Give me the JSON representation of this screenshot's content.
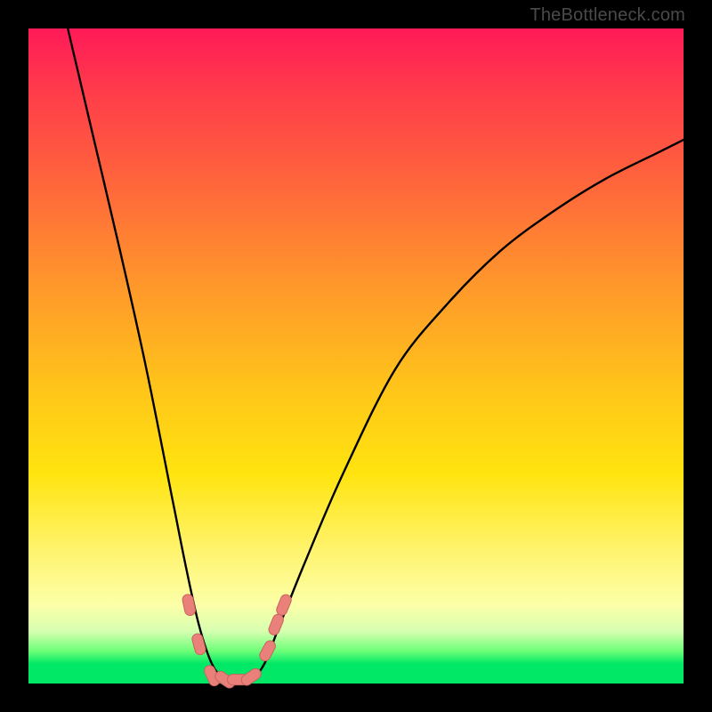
{
  "watermark": "TheBottleneck.com",
  "colors": {
    "frame_bg": "#000000",
    "gradient_top": "#ff1a58",
    "gradient_mid": "#ffe40f",
    "gradient_bottom": "#00e865",
    "curve_stroke": "#000000",
    "marker_fill": "#e98079",
    "marker_stroke": "#c9645f"
  },
  "chart_data": {
    "type": "line",
    "title": "",
    "xlabel": "",
    "ylabel": "",
    "xlim": [
      0,
      100
    ],
    "ylim": [
      0,
      100
    ],
    "note": "Axes are unlabeled; values are percentages of the plot area. y=0 is the bottom (green), y=100 is the top (red). The curve descends steeply from upper-left to a flat minimum near x≈28–34, y≈0, then rises to the right with decreasing slope.",
    "series": [
      {
        "name": "bottleneck-curve",
        "x": [
          6,
          10,
          14,
          18,
          22,
          24,
          26,
          28,
          30,
          32,
          34,
          36,
          38,
          42,
          48,
          56,
          64,
          72,
          80,
          88,
          96,
          100
        ],
        "y": [
          100,
          83,
          66,
          48,
          28,
          18,
          9,
          3,
          0.5,
          0.3,
          0.5,
          3,
          8,
          18,
          32,
          48,
          58,
          66,
          72,
          77,
          81,
          83
        ]
      }
    ],
    "markers": {
      "name": "highlighted-points",
      "note": "Coral pill-shaped markers clustered near the curve minimum on both flanks and along the flat bottom.",
      "points": [
        {
          "x": 24.5,
          "y": 12
        },
        {
          "x": 26.0,
          "y": 6
        },
        {
          "x": 28.0,
          "y": 1.2
        },
        {
          "x": 30.0,
          "y": 0.6
        },
        {
          "x": 32.0,
          "y": 0.6
        },
        {
          "x": 34.0,
          "y": 1.0
        },
        {
          "x": 36.5,
          "y": 5
        },
        {
          "x": 37.8,
          "y": 9
        },
        {
          "x": 39.0,
          "y": 12
        }
      ]
    }
  }
}
